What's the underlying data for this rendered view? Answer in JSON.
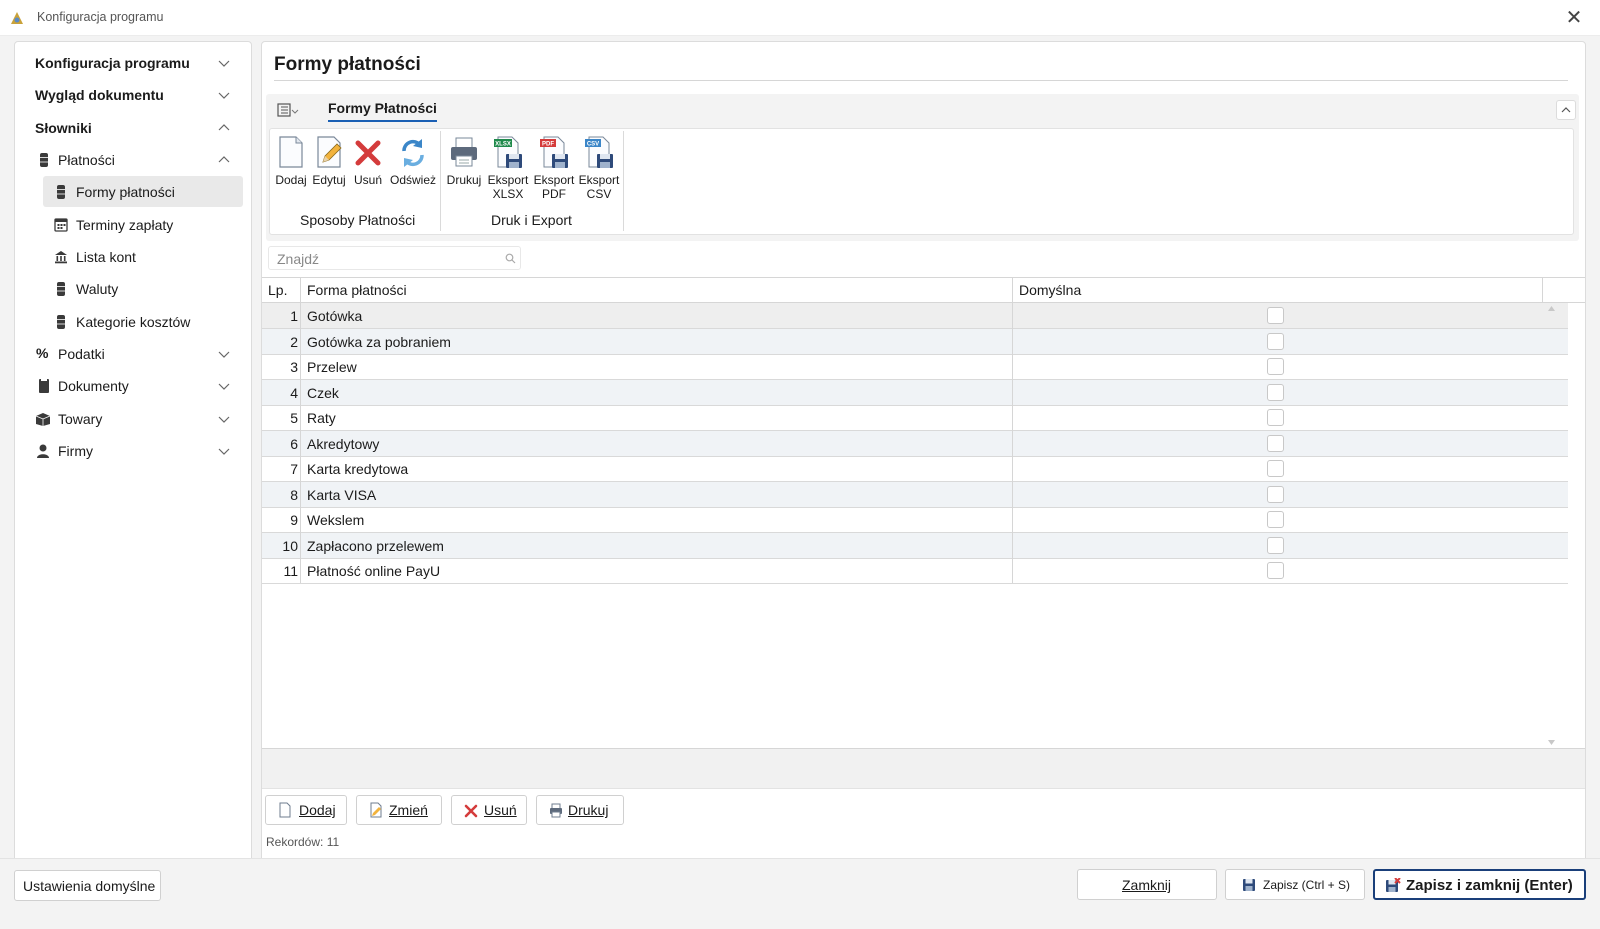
{
  "window": {
    "title": "Konfiguracja programu",
    "close_glyph": "✕"
  },
  "sidebar": {
    "items": [
      {
        "label": "Konfiguracja programu",
        "level": "top",
        "state": "collapsed"
      },
      {
        "label": "Wygląd dokumentu",
        "level": "top",
        "state": "collapsed"
      },
      {
        "label": "Słowniki",
        "level": "top",
        "state": "expanded"
      },
      {
        "label": "Płatności",
        "level": "group",
        "icon": "database-icon",
        "state": "expanded"
      },
      {
        "label": "Formy płatności",
        "level": "leaf",
        "icon": "database-icon",
        "selected": true
      },
      {
        "label": "Terminy zapłaty",
        "level": "leaf",
        "icon": "calendar-icon"
      },
      {
        "label": "Lista kont",
        "level": "leaf",
        "icon": "bank-icon"
      },
      {
        "label": "Waluty",
        "level": "leaf",
        "icon": "database-icon"
      },
      {
        "label": "Kategorie kosztów",
        "level": "leaf",
        "icon": "database-icon"
      },
      {
        "label": "Podatki",
        "level": "group",
        "icon": "percent-icon",
        "state": "collapsed"
      },
      {
        "label": "Dokumenty",
        "level": "group",
        "icon": "document-icon",
        "state": "collapsed"
      },
      {
        "label": "Towary",
        "level": "group",
        "icon": "box-icon",
        "state": "collapsed"
      },
      {
        "label": "Firmy",
        "level": "group",
        "icon": "person-icon",
        "state": "collapsed"
      }
    ]
  },
  "main": {
    "title": "Formy płatności",
    "tab": "Formy Płatności",
    "ribbon": {
      "groups": [
        {
          "label": "Sposoby Płatności",
          "buttons": [
            {
              "label": "Dodaj",
              "icon": "new-document-icon"
            },
            {
              "label": "Edytuj",
              "icon": "edit-icon"
            },
            {
              "label": "Usuń",
              "icon": "delete-icon"
            },
            {
              "label": "Odśwież",
              "icon": "refresh-icon"
            }
          ]
        },
        {
          "label": "Druk i Export",
          "buttons": [
            {
              "label": "Drukuj",
              "icon": "printer-icon"
            },
            {
              "label": "Eksport XLSX",
              "line1": "Eksport",
              "line2": "XLSX",
              "icon": "export-xlsx-icon",
              "badge": "XLSX"
            },
            {
              "label": "Eksport PDF",
              "line1": "Eksport",
              "line2": "PDF",
              "icon": "export-pdf-icon",
              "badge": "PDF"
            },
            {
              "label": "Eksport CSV",
              "line1": "Eksport",
              "line2": "CSV",
              "icon": "export-csv-icon",
              "badge": "CSV"
            }
          ]
        }
      ]
    },
    "search": {
      "placeholder": "Znajdź"
    },
    "table": {
      "columns": [
        "Lp.",
        "Forma płatności",
        "Domyślna"
      ],
      "rows": [
        {
          "lp": "1",
          "name": "Gotówka",
          "default": false
        },
        {
          "lp": "2",
          "name": "Gotówka za pobraniem",
          "default": false
        },
        {
          "lp": "3",
          "name": "Przelew",
          "default": false
        },
        {
          "lp": "4",
          "name": "Czek",
          "default": false
        },
        {
          "lp": "5",
          "name": "Raty",
          "default": false
        },
        {
          "lp": "6",
          "name": "Akredytowy",
          "default": false
        },
        {
          "lp": "7",
          "name": "Karta kredytowa",
          "default": false
        },
        {
          "lp": "8",
          "name": "Karta VISA",
          "default": false
        },
        {
          "lp": "9",
          "name": "Wekslem",
          "default": false
        },
        {
          "lp": "10",
          "name": "Zapłacono przelewem",
          "default": false
        },
        {
          "lp": "11",
          "name": "Płatność online PayU",
          "default": false
        }
      ]
    },
    "actions": {
      "add": "Dodaj",
      "change": "Zmień",
      "delete": "Usuń",
      "print": "Drukuj"
    },
    "records": "Rekordów: 11"
  },
  "footer": {
    "defaults": "Ustawienia domyślne",
    "close": "Zamknij",
    "save": "Zapisz (Ctrl + S)",
    "save_close": "Zapisz i zamknij (Enter)"
  },
  "colors": {
    "accent": "#1a5fb4",
    "delete": "#d43b3b",
    "primary_border": "#1a3f7a"
  }
}
